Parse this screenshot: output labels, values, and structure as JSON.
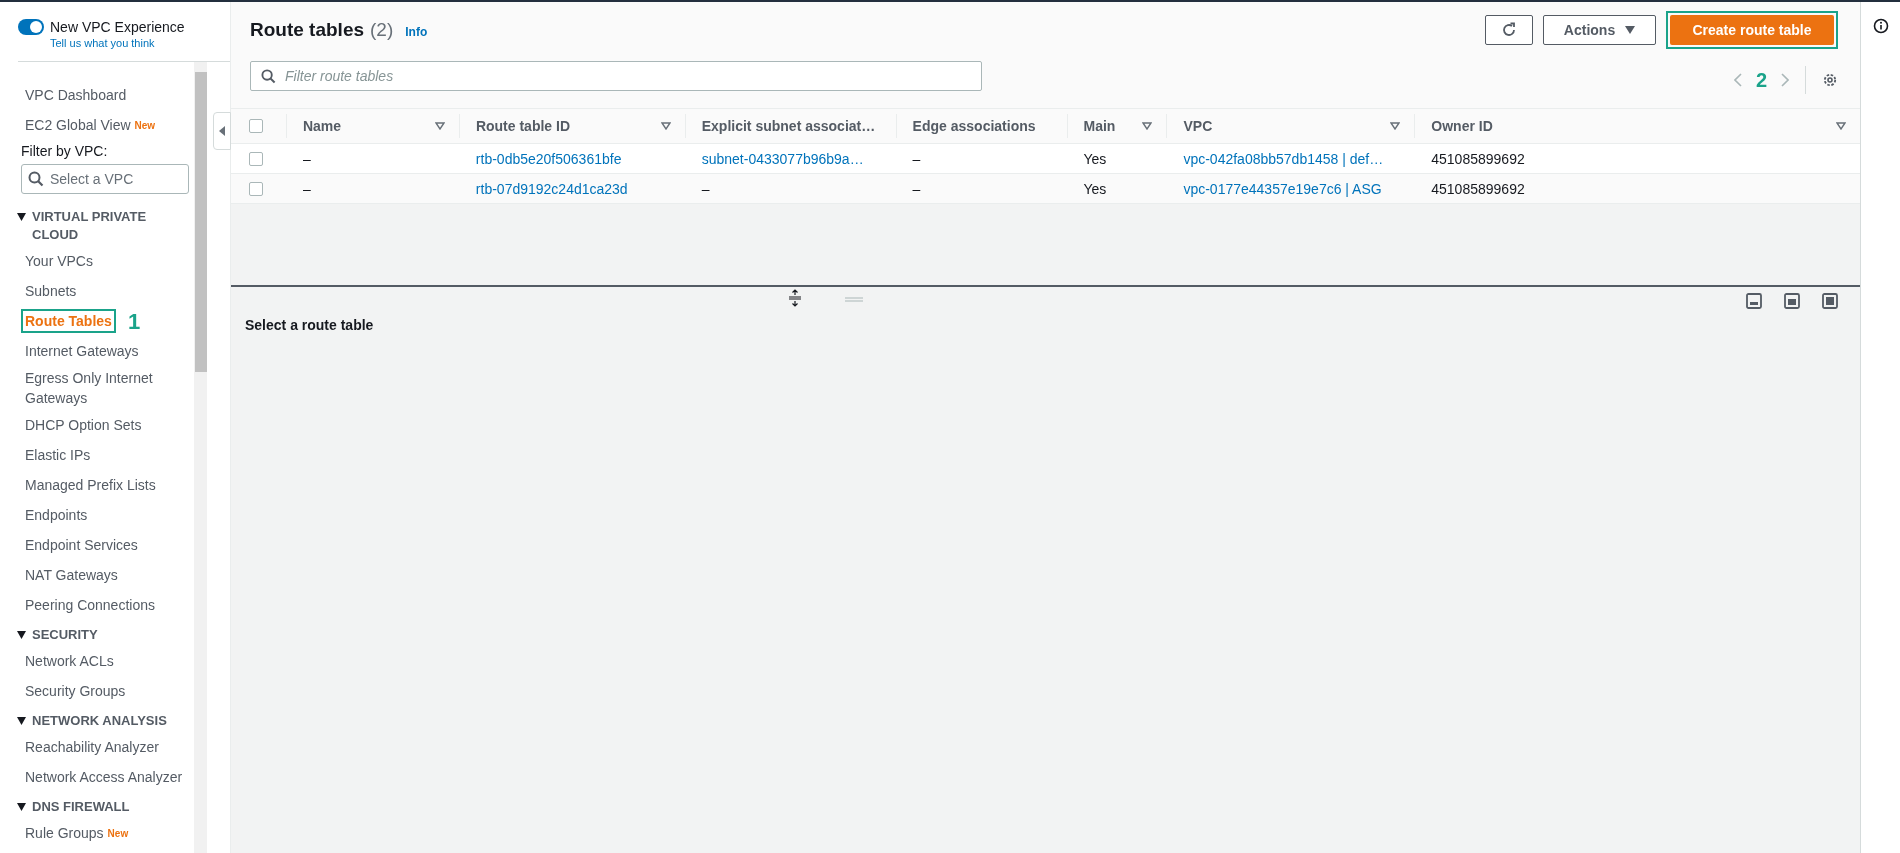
{
  "sidebar": {
    "toggle": {
      "label": "New VPC Experience",
      "on": true,
      "link": "Tell us what you think"
    },
    "items": [
      {
        "kind": "link",
        "label": "VPC Dashboard",
        "selected": false
      },
      {
        "kind": "link",
        "label": "EC2 Global View",
        "badge": "New",
        "selected": false
      },
      {
        "kind": "filter",
        "label": "Filter by VPC:",
        "placeholder": "Select a VPC"
      },
      {
        "kind": "section",
        "label": "VIRTUAL PRIVATE CLOUD",
        "expanded": true
      },
      {
        "kind": "link",
        "label": "Your VPCs",
        "selected": false
      },
      {
        "kind": "link",
        "label": "Subnets",
        "selected": false
      },
      {
        "kind": "link",
        "label": "Route Tables",
        "selected": true,
        "annotation": "1"
      },
      {
        "kind": "link",
        "label": "Internet Gateways",
        "selected": false
      },
      {
        "kind": "link",
        "label": "Egress Only Internet Gateways",
        "selected": false
      },
      {
        "kind": "link",
        "label": "DHCP Option Sets",
        "selected": false
      },
      {
        "kind": "link",
        "label": "Elastic IPs",
        "selected": false
      },
      {
        "kind": "link",
        "label": "Managed Prefix Lists",
        "selected": false
      },
      {
        "kind": "link",
        "label": "Endpoints",
        "selected": false
      },
      {
        "kind": "link",
        "label": "Endpoint Services",
        "selected": false
      },
      {
        "kind": "link",
        "label": "NAT Gateways",
        "selected": false
      },
      {
        "kind": "link",
        "label": "Peering Connections",
        "selected": false
      },
      {
        "kind": "section",
        "label": "SECURITY",
        "expanded": true
      },
      {
        "kind": "link",
        "label": "Network ACLs",
        "selected": false
      },
      {
        "kind": "link",
        "label": "Security Groups",
        "selected": false
      },
      {
        "kind": "section",
        "label": "NETWORK ANALYSIS",
        "expanded": true
      },
      {
        "kind": "link",
        "label": "Reachability Analyzer",
        "selected": false
      },
      {
        "kind": "link",
        "label": "Network Access Analyzer",
        "selected": false
      },
      {
        "kind": "section",
        "label": "DNS FIREWALL",
        "expanded": true
      },
      {
        "kind": "link",
        "label": "Rule Groups",
        "badge": "New",
        "selected": false
      }
    ]
  },
  "header": {
    "title": "Route tables",
    "count": "(2)",
    "info": "Info",
    "actions": "Actions",
    "create": "Create route table",
    "create_annotation": "2",
    "filter_placeholder": "Filter route tables"
  },
  "table": {
    "all_checked": false,
    "columns": [
      {
        "label": "Name",
        "sortable": true
      },
      {
        "label": "Route table ID",
        "sortable": true
      },
      {
        "label": "Explicit subnet associat…",
        "sortable": false
      },
      {
        "label": "Edge associations",
        "sortable": false
      },
      {
        "label": "Main",
        "sortable": true
      },
      {
        "label": "VPC",
        "sortable": true
      },
      {
        "label": "Owner ID",
        "sortable": true
      }
    ],
    "rows": [
      {
        "checked": false,
        "cells": [
          {
            "text": "–",
            "link": false
          },
          {
            "text": "rtb-0db5e20f506361bfe",
            "link": true
          },
          {
            "text": "subnet-0433077b96b9a…",
            "link": true
          },
          {
            "text": "–",
            "link": false
          },
          {
            "text": "Yes",
            "link": false
          },
          {
            "text": "vpc-042fa08bb57db1458 | def…",
            "link": true
          },
          {
            "text": "451085899692",
            "link": false
          }
        ]
      },
      {
        "checked": false,
        "cells": [
          {
            "text": "–",
            "link": false
          },
          {
            "text": "rtb-07d9192c24d1ca23d",
            "link": true
          },
          {
            "text": "–",
            "link": false
          },
          {
            "text": "–",
            "link": false
          },
          {
            "text": "Yes",
            "link": false
          },
          {
            "text": "vpc-0177e44357e19e7c6 | ASG",
            "link": true
          },
          {
            "text": "451085899692",
            "link": false
          }
        ]
      }
    ]
  },
  "details": {
    "title": "Select a route table"
  }
}
